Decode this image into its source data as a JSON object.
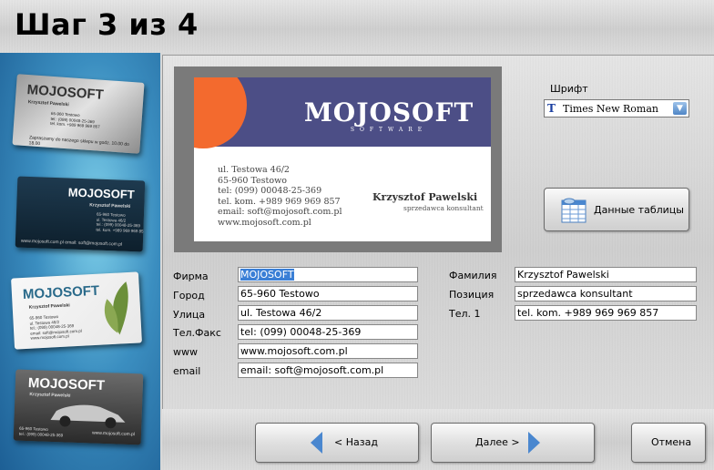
{
  "header": {
    "title": "Шаг 3 из 4"
  },
  "thumbnails": [
    {
      "logo": "MOJOSOFT",
      "name": "Krzysztof Pawelski",
      "lines": "65-960 Testowo\ntel.: (099) 00048-25-369\ntel. kom. +989 969 969 857",
      "footer": "Zapraszamy do naszego sklepu w godz. 10.00 do 18.00"
    },
    {
      "logo": "MOJOSOFT",
      "name": "Krzysztof Pawelski",
      "lines": "65-960 Testowo\nul. Testowa 46/2\ntel.: (099) 00048-25-369\ntel. kom. +989 969 969 857",
      "footer": "www.mojosoft.com.pl   email: soft@mojosoft.com.pl"
    },
    {
      "logo": "MOJOSOFT",
      "name": "Krzysztof Pawelski",
      "lines": "65-960 Testowo\nul. Testowa 46/2\ntel.: (099) 00048-25-369\nemail: soft@mojosoft.com.pl\nwww.mojosoft.com.pl"
    },
    {
      "logo": "MOJOSOFT",
      "name": "Krzysztof Pawelski",
      "lines": "65-960 Testowo\ntel.: (099) 00048-25-369",
      "footer": "www.mojosoft.com.pl"
    }
  ],
  "card": {
    "logo": "MOJOSOFT",
    "logo_sub": "SOFTWARE",
    "address_lines": [
      "ul. Testowa 46/2",
      "65-960 Testowo",
      "tel: (099) 00048-25-369",
      "tel. kom. +989 969 969 857",
      "email: soft@mojosoft.com.pl",
      "www.mojosoft.com.pl"
    ],
    "name": "Krzysztof Pawelski",
    "position": "sprzedawca konsultant",
    "colors": {
      "band": "#4c4e86",
      "accent": "#f36a2e"
    }
  },
  "font": {
    "label": "Шрифт",
    "value": "Times New Roman"
  },
  "table_button": {
    "label": "Данные таблицы"
  },
  "fields_left": [
    {
      "label": "Фирма",
      "value": "MOJOSOFT"
    },
    {
      "label": "Город",
      "value": "65-960 Testowo"
    },
    {
      "label": "Улица",
      "value": "ul. Testowa 46/2"
    },
    {
      "label": "Тел.Факс",
      "value": "tel: (099) 00048-25-369"
    },
    {
      "label": "www",
      "value": "www.mojosoft.com.pl"
    },
    {
      "label": "email",
      "value": "email: soft@mojosoft.com.pl"
    }
  ],
  "fields_right": [
    {
      "label": "Фамилия",
      "value": "Krzysztof Pawelski"
    },
    {
      "label": "Позиция",
      "value": "sprzedawca konsultant"
    },
    {
      "label": "Тел. 1",
      "value": "tel. kom. +989 969 969 857"
    }
  ],
  "footer": {
    "back_label": "< Назад",
    "next_label": "Далее >",
    "cancel_label": "Отмена"
  }
}
